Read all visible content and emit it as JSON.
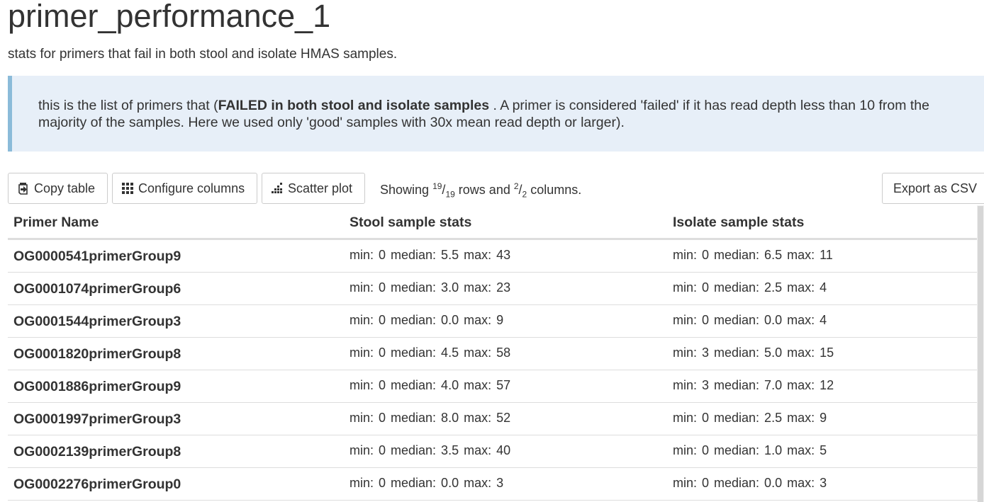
{
  "page": {
    "title": "primer_performance_1",
    "subtitle": "stats for primers that fail in both stool and isolate HMAS samples."
  },
  "callout": {
    "text_before": "this is the list of primers that (",
    "bold_text": "FAILED in both stool and isolate samples",
    "text_after": " . A primer is considered 'failed' if it has read depth less than 10 from the majority of the samples. Here we used only 'good' samples with 30x mean read depth or larger)."
  },
  "toolbar": {
    "copy_label": "Copy table",
    "configure_label": "Configure columns",
    "scatter_label": "Scatter plot",
    "export_label": "Export as CSV",
    "showing": {
      "prefix": "Showing ",
      "rows_shown": "19",
      "rows_total": "19",
      "rows_word": " rows and ",
      "cols_shown": "2",
      "cols_total": "2",
      "cols_word": " columns."
    }
  },
  "table": {
    "headers": [
      "Primer Name",
      "Stool sample stats",
      "Isolate sample stats"
    ],
    "rows": [
      {
        "name": "OG0000541primerGroup9",
        "stool": "min: 0 median: 5.5 max: 43",
        "isolate": "min: 0 median: 6.5 max: 11"
      },
      {
        "name": "OG0001074primerGroup6",
        "stool": "min: 0 median: 3.0 max: 23",
        "isolate": "min: 0 median: 2.5 max: 4"
      },
      {
        "name": "OG0001544primerGroup3",
        "stool": "min: 0 median: 0.0 max: 9",
        "isolate": "min: 0 median: 0.0 max: 4"
      },
      {
        "name": "OG0001820primerGroup8",
        "stool": "min: 0 median: 4.5 max: 58",
        "isolate": "min: 3 median: 5.0 max: 15"
      },
      {
        "name": "OG0001886primerGroup9",
        "stool": "min: 0 median: 4.0 max: 57",
        "isolate": "min: 3 median: 7.0 max: 12"
      },
      {
        "name": "OG0001997primerGroup3",
        "stool": "min: 0 median: 8.0 max: 52",
        "isolate": "min: 0 median: 2.5 max: 9"
      },
      {
        "name": "OG0002139primerGroup8",
        "stool": "min: 0 median: 3.5 max: 40",
        "isolate": "min: 0 median: 1.0 max: 5"
      },
      {
        "name": "OG0002276primerGroup0",
        "stool": "min: 0 median: 0.0 max: 3",
        "isolate": "min: 0 median: 0.0 max: 3"
      }
    ]
  },
  "icons": {
    "copy": "copy-icon",
    "configure": "grid-icon",
    "scatter": "scatter-plot-icon"
  },
  "colors": {
    "callout_bg": "#e7eff8",
    "callout_border": "#8bbbd9",
    "text": "#333333",
    "border": "#dddddd"
  }
}
